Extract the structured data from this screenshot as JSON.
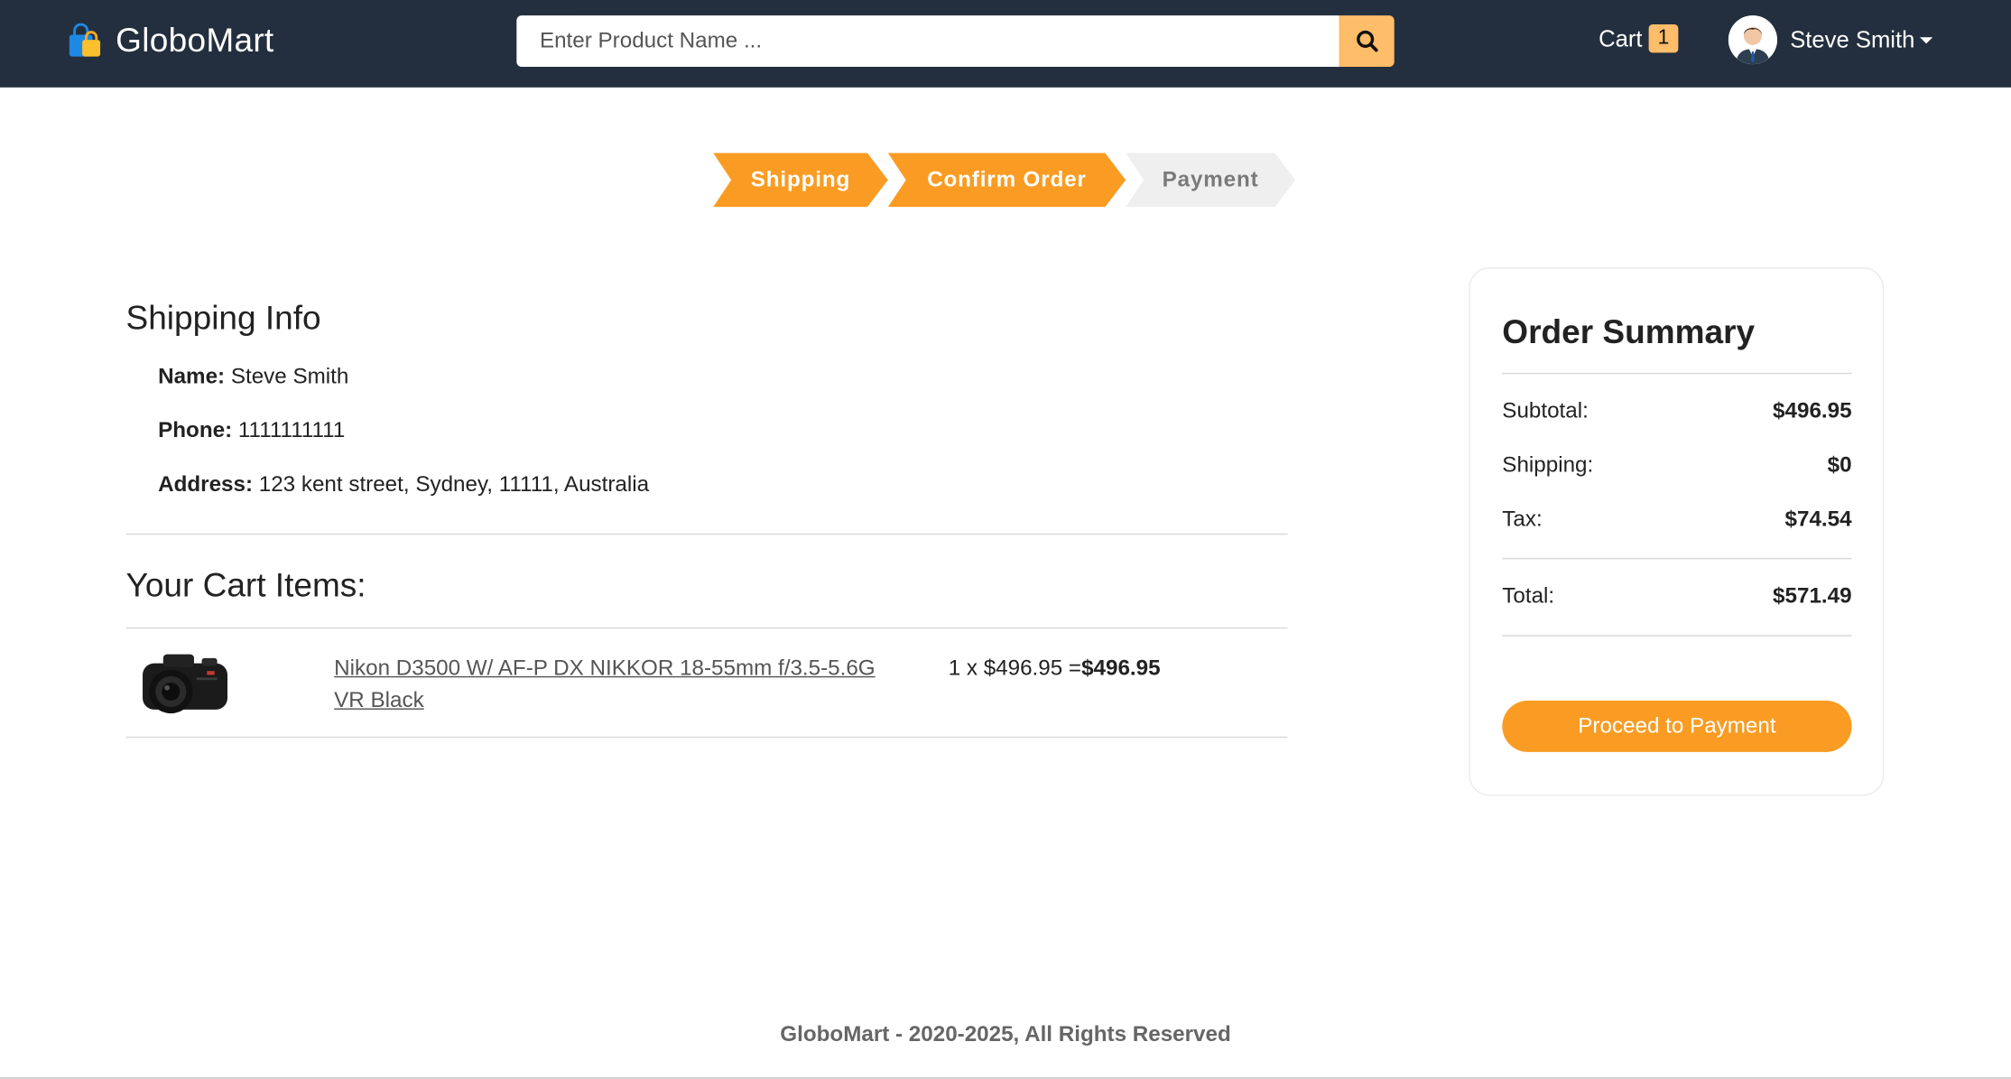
{
  "navbar": {
    "brand": "GloboMart",
    "search_placeholder": "Enter Product Name ...",
    "cart_label": "Cart",
    "cart_count": "1",
    "user_name": "Steve Smith"
  },
  "steps": [
    {
      "label": "Shipping",
      "active": true
    },
    {
      "label": "Confirm Order",
      "active": true
    },
    {
      "label": "Payment",
      "active": false
    }
  ],
  "shipping": {
    "title": "Shipping Info",
    "name_label": "Name:",
    "name": "Steve Smith",
    "phone_label": "Phone:",
    "phone": "1111111111",
    "address_label": "Address:",
    "address": "123 kent street, Sydney, 11111, Australia"
  },
  "cart": {
    "title": "Your Cart Items:",
    "items": [
      {
        "name": "Nikon D3500 W/ AF-P DX NIKKOR 18-55mm f/3.5-5.6G VR Black",
        "quantity_price": "1 x $496.95 =",
        "line_total": "$496.95"
      }
    ]
  },
  "summary": {
    "title": "Order Summary",
    "subtotal_label": "Subtotal:",
    "subtotal": "$496.95",
    "shipping_label": "Shipping:",
    "shipping": "$0",
    "tax_label": "Tax:",
    "tax": "$74.54",
    "total_label": "Total:",
    "total": "$571.49",
    "button": "Proceed to Payment"
  },
  "footer": "GloboMart - 2020-2025, All Rights Reserved",
  "colors": {
    "navbar": "#232f3e",
    "accent": "#fa9c23",
    "search_button": "#febd69",
    "step_inactive": "#efefef"
  }
}
